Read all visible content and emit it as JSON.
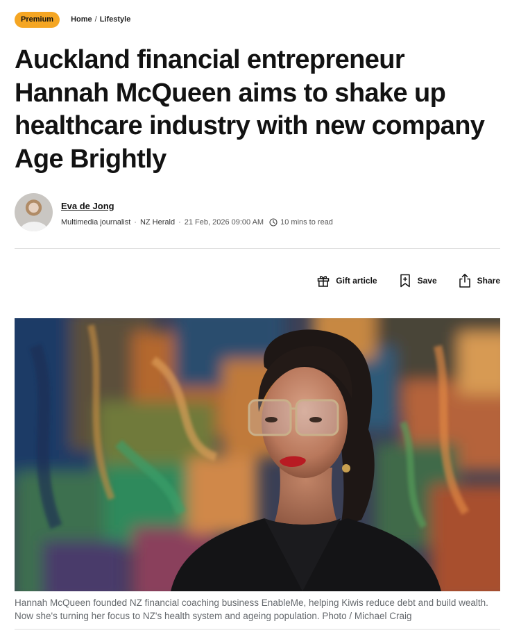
{
  "header": {
    "badge": "Premium",
    "breadcrumb": [
      "Home",
      "/",
      "Lifestyle"
    ]
  },
  "article": {
    "headline": "Auckland financial entrepreneur Hannah McQueen aims to shake up healthcare industry with new company Age Brightly",
    "author": {
      "name": "Eva de Jong",
      "role": "Multimedia journalist",
      "sep1": "·",
      "publication": "NZ Herald",
      "sep2": "·",
      "date": "21 Feb, 2026 09:00 AM",
      "read_time": "10 mins to read"
    },
    "actions": {
      "gift": "Gift article",
      "save": "Save",
      "share": "Share"
    },
    "caption": "Hannah McQueen founded NZ financial coaching business EnableMe, helping Kiwis reduce debt and build wealth. Now she's turning her focus to NZ's health system and ageing population. Photo / Michael Craig"
  },
  "icons": {
    "gift": "gift-icon",
    "save": "bookmark-add-icon",
    "share": "share-icon",
    "clock": "clock-icon"
  },
  "colors": {
    "premium_badge": "#f5a623",
    "text": "#111111",
    "caption": "#666a6e",
    "divider": "#dcdcdc"
  }
}
